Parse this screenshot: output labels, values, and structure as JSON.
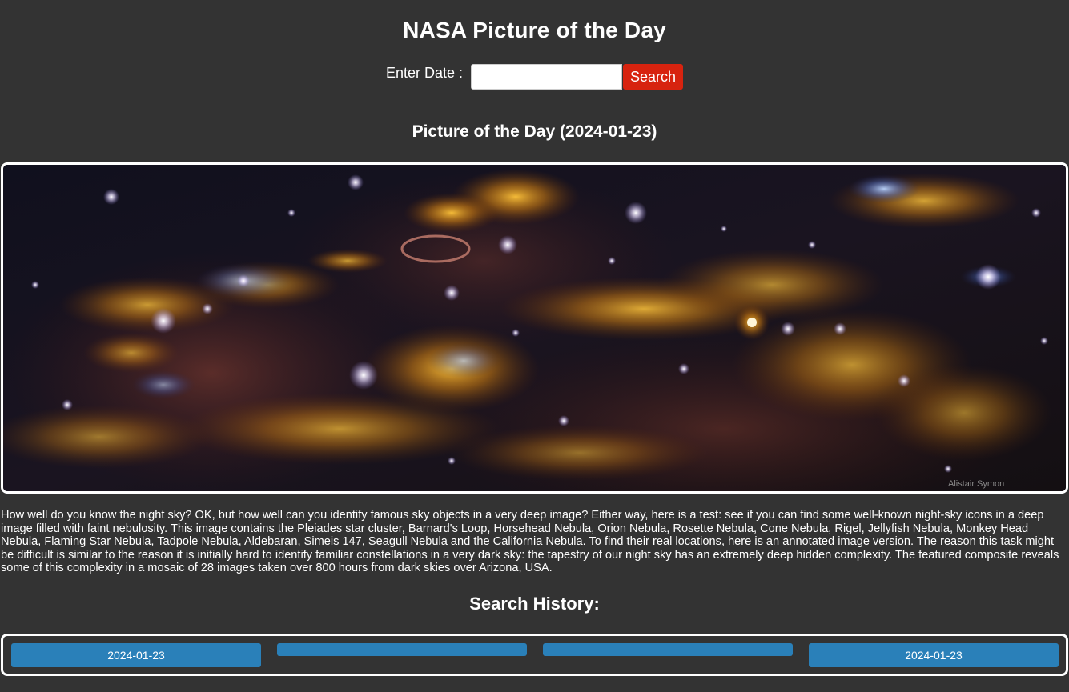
{
  "header": {
    "title": "NASA Picture of the Day"
  },
  "search": {
    "label": "Enter Date :",
    "input_value": "",
    "button_label": "Search"
  },
  "picture": {
    "heading": "Picture of the Day (2024-01-23)",
    "credit_watermark": "Alistair Symon",
    "explanation": "How well do you know the night sky? OK, but how well can you identify famous sky objects in a very deep image? Either way, here is a test: see if you can find some well-known night-sky icons in a deep image filled with faint nebulosity. This image contains the Pleiades star cluster, Barnard's Loop, Horsehead Nebula, Orion Nebula, Rosette Nebula, Cone Nebula, Rigel, Jellyfish Nebula, Monkey Head Nebula, Flaming Star Nebula, Tadpole Nebula, Aldebaran, Simeis 147, Seagull Nebula and the California Nebula. To find their real locations, here is an annotated image version. The reason this task might be difficult is similar to the reason it is initially hard to identify familiar constellations in a very dark sky: the tapestry of our night sky has an extremely deep hidden complexity. The featured composite reveals some of this complexity in a mosaic of 28 images taken over 800 hours from dark skies over Arizona, USA."
  },
  "history": {
    "heading": "Search History:",
    "items": [
      {
        "label": "2024-01-23"
      },
      {
        "label": ""
      },
      {
        "label": ""
      },
      {
        "label": "2024-01-23"
      }
    ]
  },
  "colors": {
    "background": "#333333",
    "search_button": "#d7230f",
    "history_button": "#2a80b9",
    "frame_border": "#ffffff"
  }
}
